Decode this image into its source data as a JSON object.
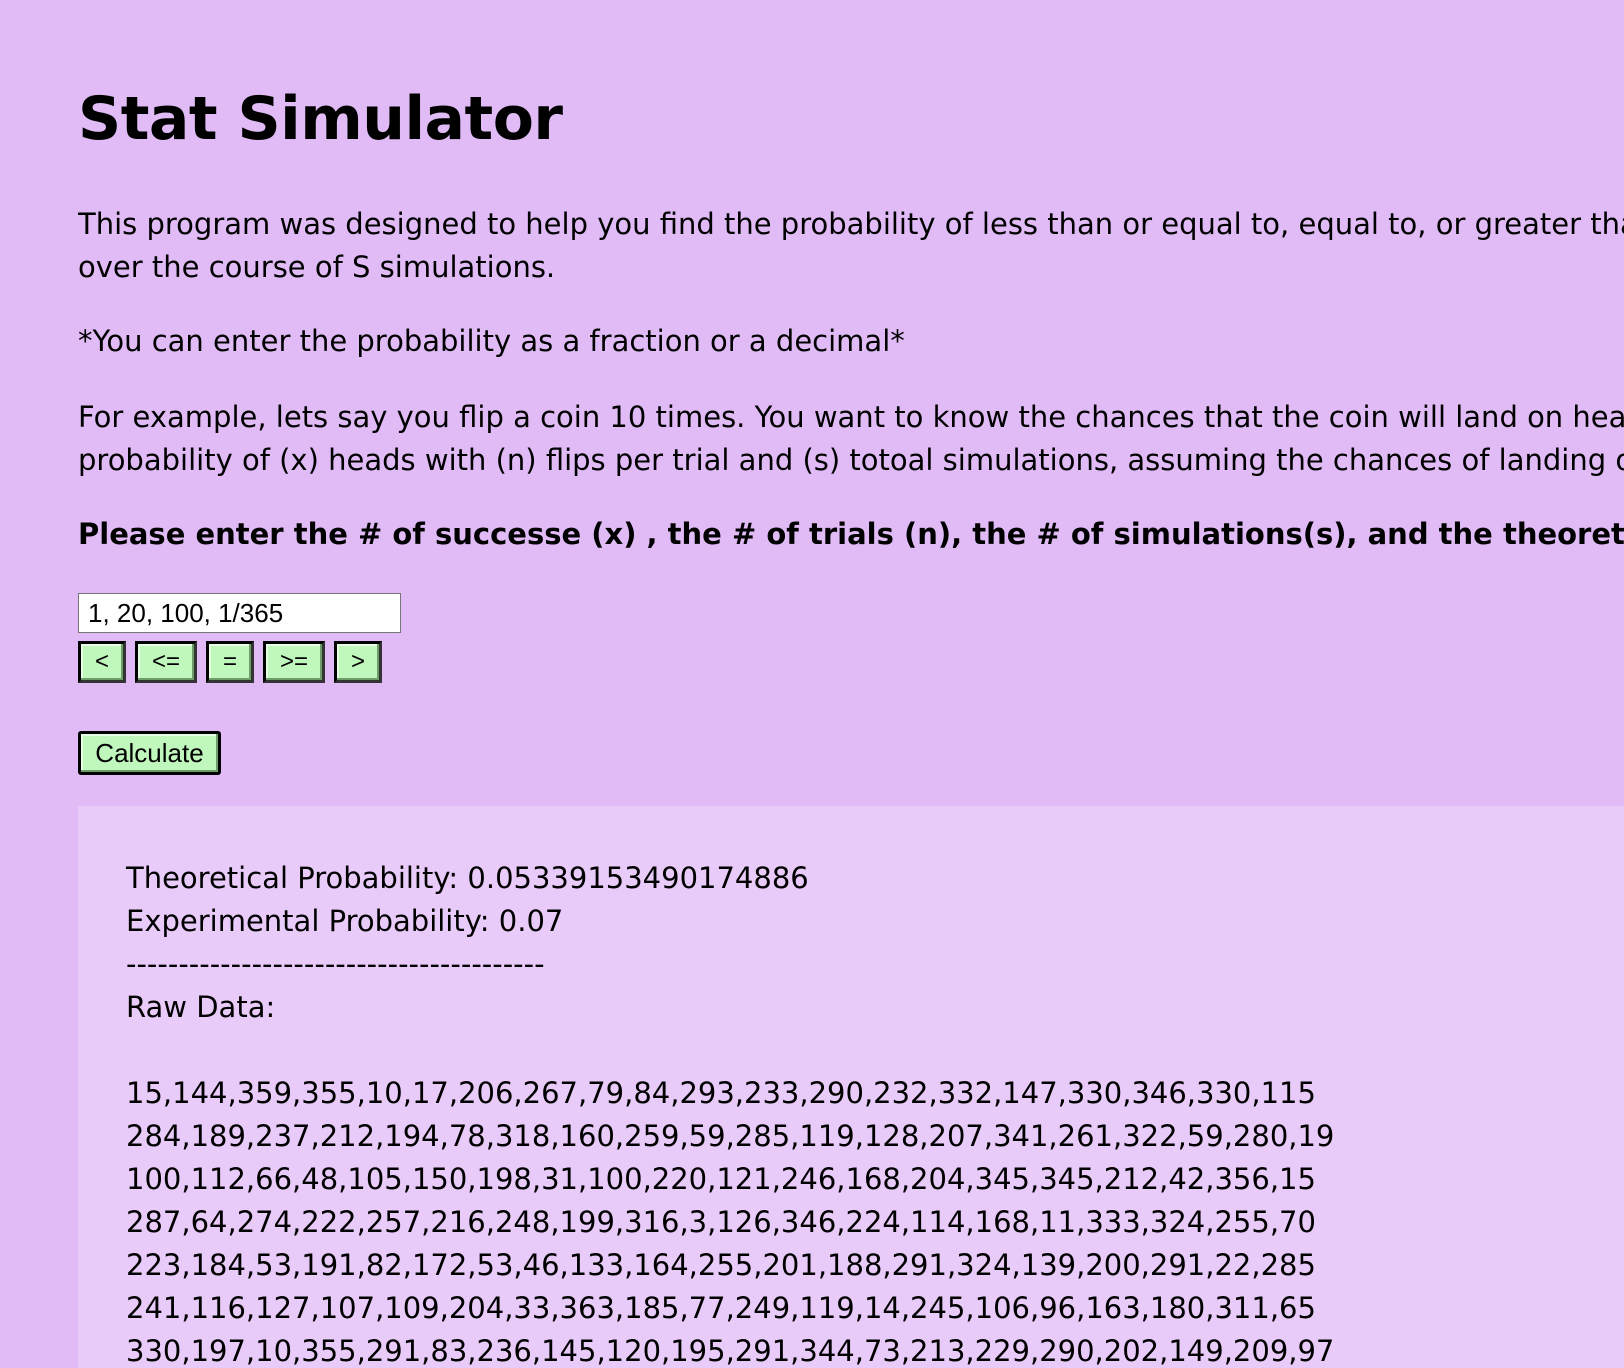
{
  "title": "Stat Simulator",
  "intro": {
    "line1": "This program was designed to help you find the probability of less than or equal to, equal to, or greater than X",
    "line2": "over the course of S simulations."
  },
  "note": "*You can enter the probability as a fraction or a decimal*",
  "example": {
    "line1": "For example, lets say you flip a coin 10 times. You want to know the chances that the coin will land on heads e",
    "line2": "probability of (x) heads with (n) flips per trial and (s) totoal simulations, assuming the chances of landing on he"
  },
  "instruction": "Please enter the # of successe (x) , the # of trials (n), the # of simulations(s), and the theoretical probab",
  "input": {
    "value": "1, 20, 100, 1/365"
  },
  "operators": [
    "<",
    "<=",
    "=",
    ">=",
    ">"
  ],
  "calculate_label": "Calculate",
  "results": {
    "theoretical": "Theoretical Probability: 0.05339153490174886",
    "experimental": "Experimental Probability: 0.07",
    "divider": "----------------------------------------",
    "raw_label": "Raw Data:",
    "raw_rows": [
      "15,144,359,355,10,17,206,267,79,84,293,233,290,232,332,147,330,346,330,115",
      "284,189,237,212,194,78,318,160,259,59,285,119,128,207,341,261,322,59,280,19",
      "100,112,66,48,105,150,198,31,100,220,121,246,168,204,345,345,212,42,356,15",
      "287,64,274,222,257,216,248,199,316,3,126,346,224,114,168,11,333,324,255,70",
      "223,184,53,191,82,172,53,46,133,164,255,201,188,291,324,139,200,291,22,285",
      "241,116,127,107,109,204,33,363,185,77,249,119,14,245,106,96,163,180,311,65",
      "330,197,10,355,291,83,236,145,120,195,291,344,73,213,229,290,202,149,209,97"
    ]
  },
  "colors": {
    "background": "#e0bbf6",
    "results_background": "#e9cbf9",
    "button_background": "#c0f7bc"
  }
}
